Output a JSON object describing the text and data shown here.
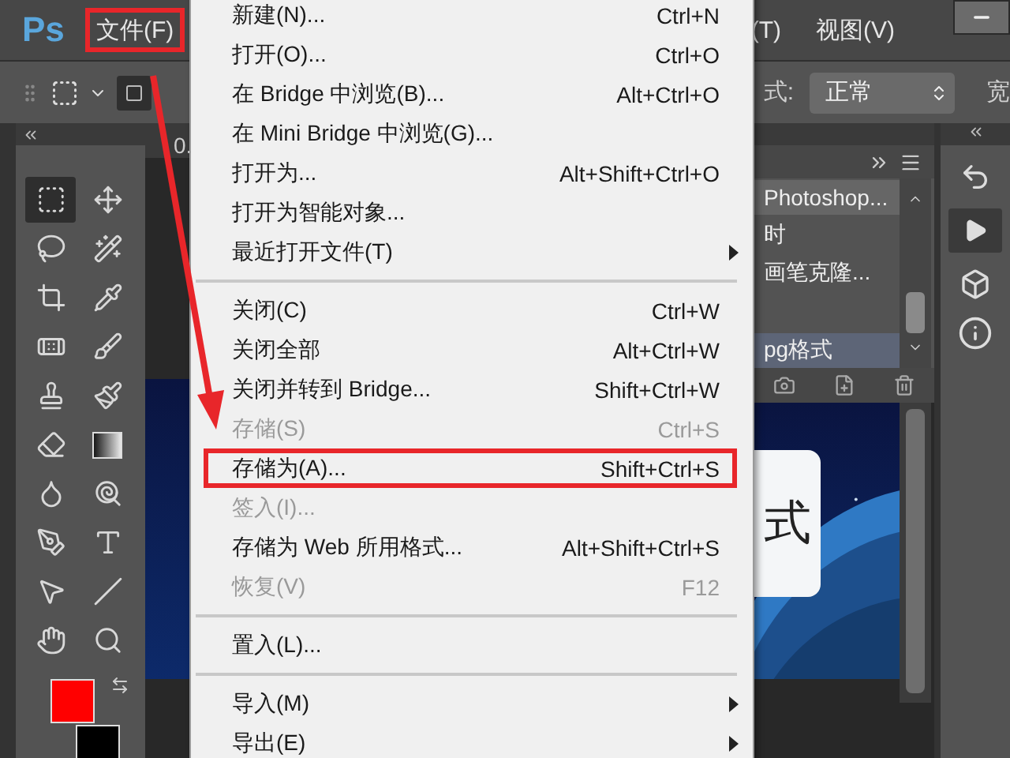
{
  "app": {
    "logo": "Ps"
  },
  "menubar": [
    {
      "label": "文件(F)",
      "highlighted": true
    },
    {
      "label": "(T)",
      "highlighted": false
    },
    {
      "label": "视图(V)",
      "highlighted": false
    }
  ],
  "options_bar": {
    "style_label": "式:",
    "style_value": "正常",
    "width_label": "宽"
  },
  "document": {
    "tab_text": "0.",
    "card_text": "式"
  },
  "tools": [
    {
      "kind": "marquee",
      "selected": true
    },
    {
      "kind": "move",
      "selected": false
    },
    {
      "kind": "lasso",
      "selected": false
    },
    {
      "kind": "wand",
      "selected": false
    },
    {
      "kind": "crop",
      "selected": false
    },
    {
      "kind": "pipette",
      "selected": false
    },
    {
      "kind": "healing",
      "selected": false
    },
    {
      "kind": "brush",
      "selected": false
    },
    {
      "kind": "stamp",
      "selected": false
    },
    {
      "kind": "history_brush",
      "selected": false
    },
    {
      "kind": "eraser",
      "selected": false
    },
    {
      "kind": "gradient",
      "selected": false
    },
    {
      "kind": "blur",
      "selected": false
    },
    {
      "kind": "dodge",
      "selected": false
    },
    {
      "kind": "pen",
      "selected": false
    },
    {
      "kind": "type",
      "selected": false
    },
    {
      "kind": "path_select",
      "selected": false
    },
    {
      "kind": "line",
      "selected": false
    },
    {
      "kind": "hand",
      "selected": false
    },
    {
      "kind": "zoom",
      "selected": false
    }
  ],
  "file_menu": [
    {
      "kind": "item",
      "label": "新建(N)...",
      "shortcut": "Ctrl+N",
      "disabled": false,
      "highlighted": false
    },
    {
      "kind": "item",
      "label": "打开(O)...",
      "shortcut": "Ctrl+O",
      "disabled": false,
      "highlighted": false
    },
    {
      "kind": "item",
      "label": "在 Bridge 中浏览(B)...",
      "shortcut": "Alt+Ctrl+O",
      "disabled": false,
      "highlighted": false
    },
    {
      "kind": "item",
      "label": "在 Mini Bridge 中浏览(G)...",
      "disabled": false,
      "highlighted": false
    },
    {
      "kind": "item",
      "label": "打开为...",
      "shortcut": "Alt+Shift+Ctrl+O",
      "disabled": false,
      "highlighted": false
    },
    {
      "kind": "item",
      "label": "打开为智能对象...",
      "disabled": false,
      "highlighted": false
    },
    {
      "kind": "submenu",
      "label": "最近打开文件(T)",
      "disabled": false,
      "highlighted": false
    },
    {
      "kind": "separator"
    },
    {
      "kind": "item",
      "label": "关闭(C)",
      "shortcut": "Ctrl+W",
      "disabled": false,
      "highlighted": false
    },
    {
      "kind": "item",
      "label": "关闭全部",
      "shortcut": "Alt+Ctrl+W",
      "disabled": false,
      "highlighted": false
    },
    {
      "kind": "item",
      "label": "关闭并转到 Bridge...",
      "shortcut": "Shift+Ctrl+W",
      "disabled": false,
      "highlighted": false
    },
    {
      "kind": "item",
      "label": "存储(S)",
      "shortcut": "Ctrl+S",
      "disabled": true,
      "highlighted": false
    },
    {
      "kind": "item",
      "label": "存储为(A)...",
      "shortcut": "Shift+Ctrl+S",
      "disabled": false,
      "highlighted": true
    },
    {
      "kind": "item",
      "label": "签入(I)...",
      "disabled": true,
      "highlighted": false
    },
    {
      "kind": "item",
      "label": "存储为 Web 所用格式...",
      "shortcut": "Alt+Shift+Ctrl+S",
      "disabled": false,
      "highlighted": false
    },
    {
      "kind": "item",
      "label": "恢复(V)",
      "shortcut": "F12",
      "disabled": true,
      "highlighted": false
    },
    {
      "kind": "separator"
    },
    {
      "kind": "item",
      "label": "置入(L)...",
      "disabled": false,
      "highlighted": false
    },
    {
      "kind": "separator"
    },
    {
      "kind": "submenu",
      "label": "导入(M)",
      "disabled": false,
      "highlighted": false
    },
    {
      "kind": "submenu",
      "label": "导出(E)",
      "disabled": false,
      "highlighted": false
    }
  ],
  "history_panel": [
    {
      "kind": "snapshot",
      "label": "Photoshop...",
      "selected": false
    },
    {
      "kind": "state",
      "label": "时",
      "selected": false
    },
    {
      "kind": "state",
      "label": "画笔克隆...",
      "selected": false
    },
    {
      "kind": "state",
      "label": "pg格式",
      "selected": true
    }
  ]
}
